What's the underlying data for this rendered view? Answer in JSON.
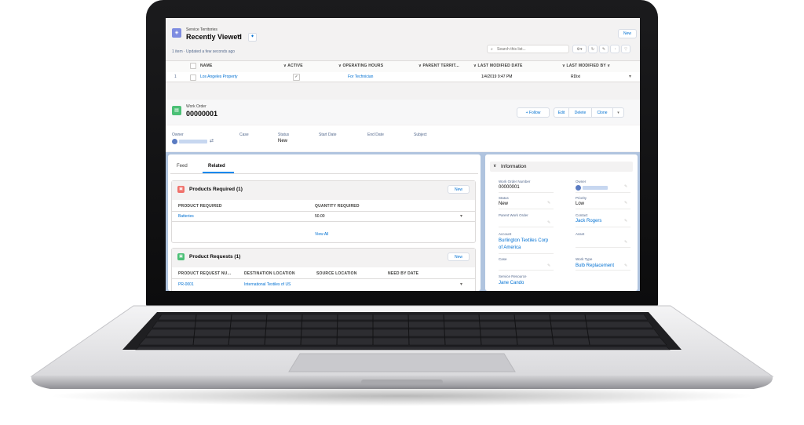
{
  "list_view": {
    "object_label": "Service Territories",
    "title": "Recently Viewed",
    "subtitle": "1 item · Updated a few seconds ago",
    "new_label": "New",
    "search_placeholder": "Search this list...",
    "columns": [
      "NAME",
      "ACTIVE",
      "OPERATING HOURS",
      "PARENT TERRIT...",
      "LAST MODIFIED DATE",
      "LAST MODIFIED BY"
    ],
    "rows": [
      {
        "num": "1",
        "name": "Los Angeles Property",
        "active_check": "✓",
        "operating_hours": "For Technician",
        "parent": "",
        "modified_date": "1/4/2019 9:47 PM",
        "modified_by": "RDixi"
      }
    ]
  },
  "record": {
    "object_label": "Work Order",
    "number": "00000001",
    "actions": {
      "follow": "+ Follow",
      "edit": "Edit",
      "delete": "Delete",
      "clone": "Clone"
    },
    "highlights": {
      "owner_label": "Owner",
      "case_label": "Case",
      "status_label": "Status",
      "status_value": "New",
      "start_label": "Start Date",
      "end_label": "End Date",
      "subject_label": "Subject"
    }
  },
  "tabs": [
    "Feed",
    "Related"
  ],
  "products_required": {
    "title": "Products Required (1)",
    "new_label": "New",
    "columns": [
      "PRODUCT REQUIRED",
      "QUANTITY REQUIRED"
    ],
    "rows": [
      {
        "product": "Batteries",
        "quantity": "50.00"
      }
    ],
    "view_all": "View All"
  },
  "product_requests": {
    "title": "Product Requests (1)",
    "new_label": "New",
    "columns": [
      "PRODUCT REQUEST NU...",
      "DESTINATION LOCATION",
      "SOURCE LOCATION",
      "NEED BY DATE"
    ],
    "rows": [
      {
        "number": "PR-0001",
        "destination": "International Textiles of US",
        "source": "",
        "need_by": ""
      }
    ]
  },
  "information": {
    "title": "Information",
    "work_order_number_label": "Work Order Number",
    "work_order_number": "00000001",
    "owner_label": "Owner",
    "status_label": "Status",
    "status": "New",
    "priority_label": "Priority",
    "priority": "Low",
    "parent_label": "Parent Work Order",
    "contact_label": "Contact",
    "contact": "Jack Rogers",
    "account_label": "Account",
    "account": "Burlington Textiles Corp of America",
    "asset_label": "Asset",
    "case_label": "Case",
    "work_type_label": "Work Type",
    "work_type": "Bulb Replacement",
    "service_resource_label": "Service Resource",
    "service_resource": "Jane Cando"
  },
  "colors": {
    "brand": "#0070d2",
    "territory_icon": "#7f8de1",
    "work_order_icon": "#4bc076",
    "products_icon": "#f0716b",
    "requests_icon": "#4bc076"
  },
  "icons": [
    "territory-icon",
    "pin-icon",
    "search-icon",
    "gear-icon",
    "refresh-icon",
    "pencil-icon",
    "filter-icon",
    "chart-icon",
    "work-order-icon",
    "user-icon",
    "chevron-down-icon",
    "products-icon",
    "requests-icon",
    "checkbox-icon"
  ]
}
